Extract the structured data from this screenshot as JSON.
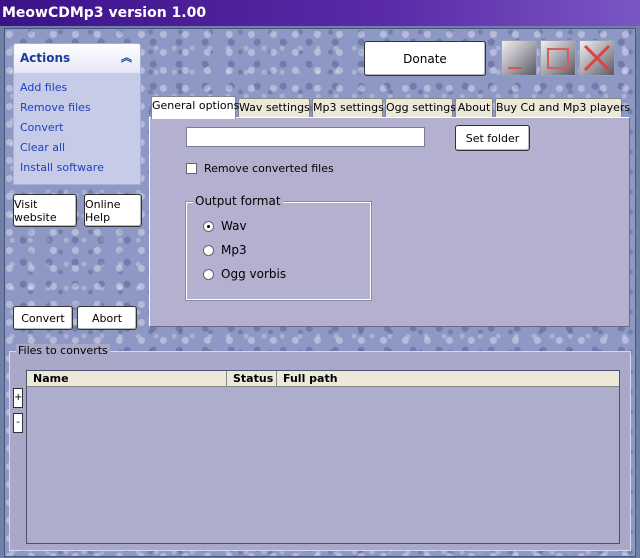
{
  "window": {
    "title": "MeowCDMp3 version 1.00"
  },
  "actions": {
    "header": "Actions",
    "items": [
      {
        "label": "Add files"
      },
      {
        "label": "Remove files"
      },
      {
        "label": "Convert"
      },
      {
        "label": "Clear all"
      },
      {
        "label": "Install software"
      }
    ]
  },
  "buttons": {
    "visit_website": "Visit website",
    "online_help": "Online Help",
    "convert": "Convert",
    "abort": "Abort",
    "donate": "Donate",
    "set_folder": "Set folder"
  },
  "tabs": [
    {
      "label": "General options",
      "active": true
    },
    {
      "label": "Wav settings"
    },
    {
      "label": "Mp3 settings"
    },
    {
      "label": "Ogg settings"
    },
    {
      "label": "About"
    },
    {
      "label": "Buy Cd and Mp3 players"
    }
  ],
  "general": {
    "folder_value": "",
    "remove_converted_label": "Remove converted files",
    "remove_converted_checked": false,
    "output_format_title": "Output format",
    "formats": [
      {
        "label": "Wav",
        "selected": true
      },
      {
        "label": "Mp3",
        "selected": false
      },
      {
        "label": "Ogg vorbis",
        "selected": false
      }
    ]
  },
  "files": {
    "title": "Files to converts",
    "columns": [
      "Name",
      "Status",
      "Full path"
    ],
    "add_label": "+",
    "remove_label": "-",
    "rows": []
  },
  "colors": {
    "title_bar": "#3c1288",
    "link": "#2040c0",
    "panel": "#b3b1cf"
  }
}
